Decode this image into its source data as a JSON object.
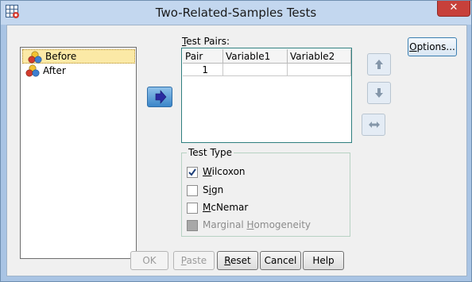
{
  "window": {
    "title": "Two-Related-Samples Tests",
    "close_label": "✕"
  },
  "variable_list": {
    "items": [
      {
        "label": "Before",
        "selected": true
      },
      {
        "label": "After",
        "selected": false
      }
    ]
  },
  "test_pairs": {
    "label_prefix": "T",
    "label_rest": "est Pairs:",
    "columns": [
      "Pair",
      "Variable1",
      "Variable2"
    ],
    "rows": [
      {
        "pair": "1",
        "variable1": "",
        "variable2": ""
      }
    ]
  },
  "options_button": {
    "prefix": "",
    "key": "O",
    "rest": "ptions..."
  },
  "test_type": {
    "legend": "Test Type",
    "options": [
      {
        "key": "W",
        "rest": "ilcoxon",
        "prefix": "",
        "checked": true,
        "enabled": true
      },
      {
        "prefix": "S",
        "key": "i",
        "rest": "gn",
        "checked": false,
        "enabled": true
      },
      {
        "key": "M",
        "rest": "cNemar",
        "prefix": "",
        "checked": false,
        "enabled": true
      },
      {
        "prefix": "Marginal ",
        "key": "H",
        "rest": "omogeneity",
        "checked": false,
        "enabled": false
      }
    ]
  },
  "buttons": {
    "ok": {
      "prefix": "OK",
      "key": "",
      "rest": "",
      "enabled": false
    },
    "paste": {
      "prefix": "",
      "key": "P",
      "rest": "aste",
      "enabled": false
    },
    "reset": {
      "prefix": "",
      "key": "R",
      "rest": "eset",
      "enabled": true
    },
    "cancel": {
      "prefix": "Cancel",
      "key": "",
      "rest": "",
      "enabled": true
    },
    "help": {
      "prefix": "Help",
      "key": "",
      "rest": "",
      "enabled": true
    }
  },
  "colors": {
    "accent_blue": "#3b86c9",
    "title_bar": "#c3d7ef",
    "close_red": "#c7403a",
    "selection": "#fbe9a6"
  }
}
